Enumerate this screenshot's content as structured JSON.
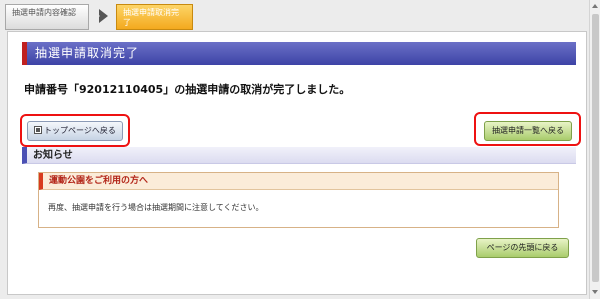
{
  "steps": {
    "step1_label": "抽選申請内容確認",
    "step2_label": "抽選申請取消完了"
  },
  "page_title": "抽選申請取消完了",
  "complete_message": "申請番号「92012110405」の抽選申請の取消が完了しました。",
  "buttons": {
    "top_page": "トップページへ戻る",
    "lottery_list": "抽選申請一覧へ戻る",
    "page_top": "ページの先頭に戻る"
  },
  "notice": {
    "heading": "お知らせ",
    "box_title": "運動公園をご利用の方へ",
    "box_body": "再度、抽選申請を行う場合は抽選期間に注意してください。"
  },
  "colors": {
    "title_bar": "#3d43a6",
    "highlight": "#e11111",
    "step_active": "#f3a91e"
  }
}
